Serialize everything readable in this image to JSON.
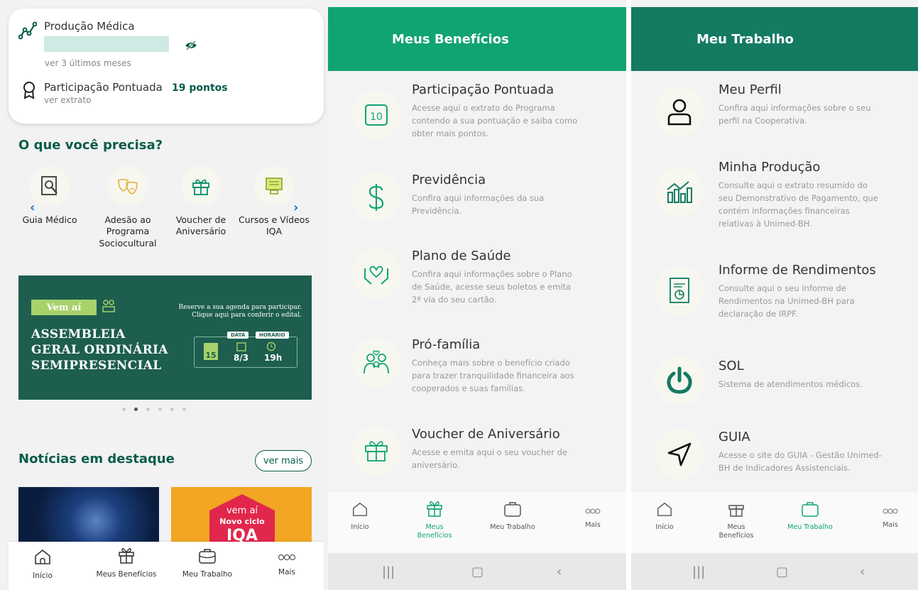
{
  "screen1": {
    "producao": {
      "title": "Produção Médica",
      "link": "ver 3 últimos meses"
    },
    "participacao": {
      "title": "Participação Pontuada",
      "points": "19 pontos",
      "link": "ver extrato"
    },
    "section_title": "O que você precisa?",
    "quick_actions": [
      {
        "label_lines": [
          "Guia Médico"
        ]
      },
      {
        "label_lines": [
          "Adesão ao",
          "Programa",
          "Sociocultural"
        ]
      },
      {
        "label_lines": [
          "Voucher de",
          "Aniversário"
        ]
      },
      {
        "label_lines": [
          "Cursos e Vídeos",
          "IQA"
        ]
      }
    ],
    "banner": {
      "pill": "Vem aí",
      "headline_lines": [
        "ASSEMBLEIA",
        "GERAL ORDINÁRIA",
        "SEMIPRESENCIAL"
      ],
      "reserve_lines": [
        "Reserve a sua agenda para participar.",
        "Clique aqui para conferir o edital."
      ],
      "data_tag": "DATA",
      "horario_tag": "HORÁRIO",
      "day": "15",
      "date": "8/3",
      "time": "19h"
    },
    "news_title": "Notícias em destaque",
    "ver_mais": "ver mais",
    "news2": {
      "line1": "vem aí",
      "line2": "Novo ciclo",
      "line3": "IQA"
    },
    "nav": [
      "Início",
      "Meus Benefícios",
      "Meu Trabalho",
      "Mais"
    ]
  },
  "screen2": {
    "header": "Meus Benefícios",
    "items": [
      {
        "title": "Participação Pontuada",
        "desc_lines": [
          "Acesse aqui o extrato do Programa",
          "contendo a sua pontuação e saiba como",
          "obter mais pontos."
        ]
      },
      {
        "title": "Previdência",
        "desc_lines": [
          "Confira aqui informações da sua",
          "Previdência."
        ]
      },
      {
        "title": "Plano de Saúde",
        "desc_lines": [
          "Confira aqui informações sobre o Plano",
          "de Saúde, acesse seus boletos e emita",
          "2ª via do seu cartão."
        ]
      },
      {
        "title": "Pró-família",
        "desc_lines": [
          "Conheça mais sobre o benefício criado",
          "para trazer tranquilidade financeira aos",
          "cooperados e suas famílias."
        ]
      },
      {
        "title": "Voucher de Aniversário",
        "desc_lines": [
          "Acesse e emita aqui o seu voucher de",
          "aniversário."
        ]
      }
    ],
    "calendar_number": "10",
    "nav": [
      [
        "Início"
      ],
      [
        "Meus",
        "Benefícios"
      ],
      [
        "Meu Trabalho"
      ],
      [
        "Mais"
      ]
    ]
  },
  "screen3": {
    "header": "Meu Trabalho",
    "items": [
      {
        "title": "Meu Perfil",
        "desc_lines": [
          "Confira aqui informações sobre o seu",
          "perfil na Cooperativa."
        ]
      },
      {
        "title": "Minha Produção",
        "desc_lines": [
          "Consulte aqui o extrato resumido do",
          "seu Demonstrativo de Pagamento, que",
          "contém informações financeiras",
          "relativas à Unimed-BH."
        ]
      },
      {
        "title": "Informe de Rendimentos",
        "desc_lines": [
          "Consulte aqui o seu Informe de",
          "Rendimentos na Unimed-BH para",
          "declaração de IRPF."
        ]
      },
      {
        "title": "SOL",
        "desc_lines": [
          "Sistema de atendimentos médicos."
        ]
      },
      {
        "title": "GUIA",
        "desc_lines": [
          "Acesse o site do GUIA - Gestão Unimed-",
          "BH de Indicadores Assistenciais."
        ]
      }
    ],
    "nav": [
      [
        "Início"
      ],
      [
        "Meus",
        "Benefícios"
      ],
      [
        "Meu Trabalho"
      ],
      [
        "Mais"
      ]
    ]
  },
  "colors": {
    "primary_green": "#10a373",
    "dark_green": "#147a62",
    "text_green": "#0a5c4b",
    "banner_green": "#1d5e4f"
  }
}
